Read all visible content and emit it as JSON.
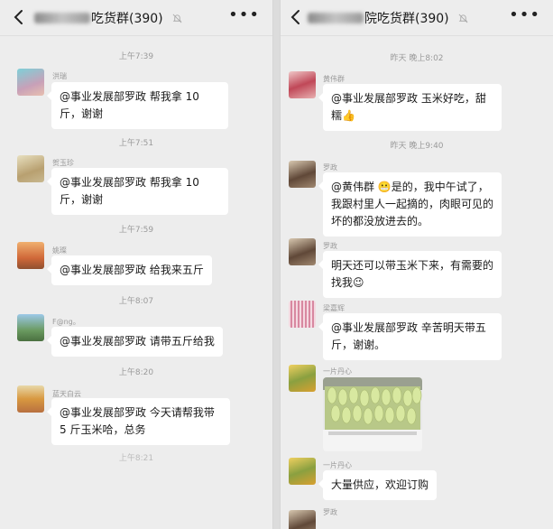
{
  "left": {
    "title_visible": "吃货群(390)",
    "messages": [
      {
        "time": "上午7:39",
        "sender": "洪瑞",
        "text": "@事业发展部罗政  帮我拿 10 斤，谢谢"
      },
      {
        "time": "上午7:51",
        "sender": "贺玉珍",
        "text": "@事业发展部罗政  帮我拿 10 斤，谢谢"
      },
      {
        "time": "上午7:59",
        "sender": "姚璨",
        "text": "@事业发展部罗政  给我来五斤"
      },
      {
        "time": "上午8:07",
        "sender": "F@ng。",
        "text": "@事业发展部罗政  请带五斤给我"
      },
      {
        "time": "上午8:20",
        "sender": "蓝天白云",
        "text": "@事业发展部罗政  今天请帮我带 5 斤玉米哈，总务"
      }
    ]
  },
  "right": {
    "title_visible": "院吃货群(390)",
    "messages": [
      {
        "time": "昨天 晚上8:02",
        "sender": "黄伟群",
        "text": "@事业发展部罗政  玉米好吃，甜糯",
        "emoji": "👍"
      },
      {
        "time": "昨天 晚上9:40",
        "sender": "罗政",
        "text": "@黄伟群 ",
        "emoji": "😬",
        "text2": "是的，我中午试了，我跟村里人一起摘的，肉眼可见的坏的都没放进去的。"
      },
      {
        "sender": "罗政",
        "text": "明天还可以带玉米下来，有需要的找我",
        "emoji": "😉"
      },
      {
        "sender": "梁嘉辉",
        "text": "@事业发展部罗政  辛苦明天带五斤，谢谢。"
      },
      {
        "sender": "一片丹心",
        "photo": "trunk-full-of-corn"
      },
      {
        "sender": "一片丹心",
        "text": "大量供应，欢迎订购"
      },
      {
        "sender": "罗政"
      }
    ]
  }
}
